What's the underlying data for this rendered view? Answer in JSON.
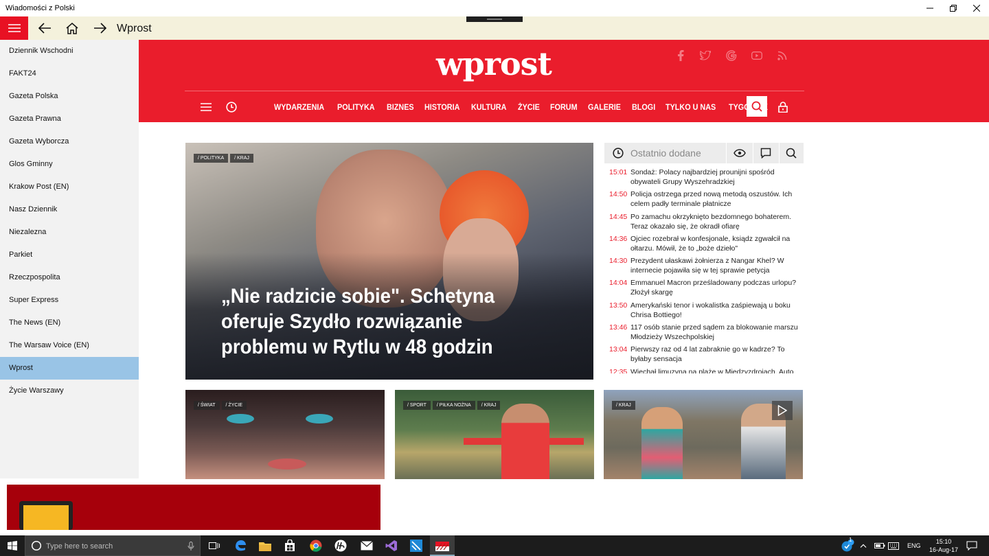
{
  "window": {
    "title": "Wiadomości z Polski"
  },
  "appbar": {
    "title": "Wprost"
  },
  "sidebar": {
    "items": [
      {
        "label": "Dziennik Wschodni"
      },
      {
        "label": "FAKT24"
      },
      {
        "label": "Gazeta Polska"
      },
      {
        "label": "Gazeta Prawna"
      },
      {
        "label": "Gazeta Wyborcza"
      },
      {
        "label": "Glos Gminny"
      },
      {
        "label": "Krakow Post (EN)"
      },
      {
        "label": "Nasz Dziennik"
      },
      {
        "label": "Niezalezna"
      },
      {
        "label": "Parkiet"
      },
      {
        "label": "Rzeczpospolita"
      },
      {
        "label": "Super Express"
      },
      {
        "label": "The News (EN)"
      },
      {
        "label": "The Warsaw Voice (EN)"
      },
      {
        "label": "Wprost"
      },
      {
        "label": "Życie Warszawy"
      }
    ],
    "active": "Wprost"
  },
  "site": {
    "logo": "wprost",
    "brand_color": "#ea1d2c",
    "nav": [
      "WYDARZENIA",
      "POLITYKA",
      "BIZNES",
      "HISTORIA",
      "KULTURA",
      "ŻYCIE",
      "FORUM",
      "GALERIE",
      "BLOGI",
      "TYLKO U NAS",
      "TYGODNIK"
    ],
    "social_icons": [
      "facebook-icon",
      "twitter-icon",
      "google-icon",
      "youtube-icon",
      "rss-icon"
    ]
  },
  "hero": {
    "tags": [
      "/ POLITYKA",
      "/ KRAJ"
    ],
    "title": "„Nie radzicie sobie\". Schetyna oferuje Szydło rozwiązanie problemu w Rytlu w 48 godzin"
  },
  "recent": {
    "label": "Ostatnio dodane",
    "items": [
      {
        "time": "15:01",
        "text": "Sondaż: Polacy najbardziej prounijni spośród obywateli Grupy Wyszehradzkiej"
      },
      {
        "time": "14:50",
        "text": "Policja ostrzega przed nową metodą oszustów. Ich celem padły terminale płatnicze"
      },
      {
        "time": "14:45",
        "text": "Po zamachu okrzyknięto bezdomnego bohaterem. Teraz okazało się, że okradł ofiarę"
      },
      {
        "time": "14:36",
        "text": "Ojciec rozebrał w konfesjonale, ksiądz zgwałcił na ołtarzu. Mówił, że to „boże dzieło\""
      },
      {
        "time": "14:30",
        "text": "Prezydent ułaskawi żołnierza z Nangar Khel? W internecie pojawiła się w tej sprawie petycja"
      },
      {
        "time": "14:04",
        "text": "Emmanuel Macron prześladowany podczas urlopu? Złożył skargę"
      },
      {
        "time": "13:50",
        "text": "Amerykański tenor i wokalistka zaśpiewają u boku Chrisa Bottiego!"
      },
      {
        "time": "13:46",
        "text": "117 osób stanie przed sądem za blokowanie marszu Młodzieży Wszechpolskiej"
      },
      {
        "time": "13:04",
        "text": "Pierwszy raz od 4 lat zabraknie go w kadrze? To byłaby sensacja"
      },
      {
        "time": "12:35",
        "text": "Wiechał limuzyną na plażę w Międzyzdrojach. Auto"
      }
    ]
  },
  "cards": [
    {
      "tags": [
        "/ ŚWIAT",
        "/ ŻYCIE"
      ]
    },
    {
      "tags": [
        "/ SPORT",
        "/ PIŁKA NOŻNA",
        "/ KRAJ"
      ]
    },
    {
      "tags": [
        "/ KRAJ"
      ]
    }
  ],
  "taskbar": {
    "search_placeholder": "Type here to search",
    "lang": "ENG",
    "time": "15:10",
    "date": "16-Aug-17",
    "notif_badge": "1"
  }
}
